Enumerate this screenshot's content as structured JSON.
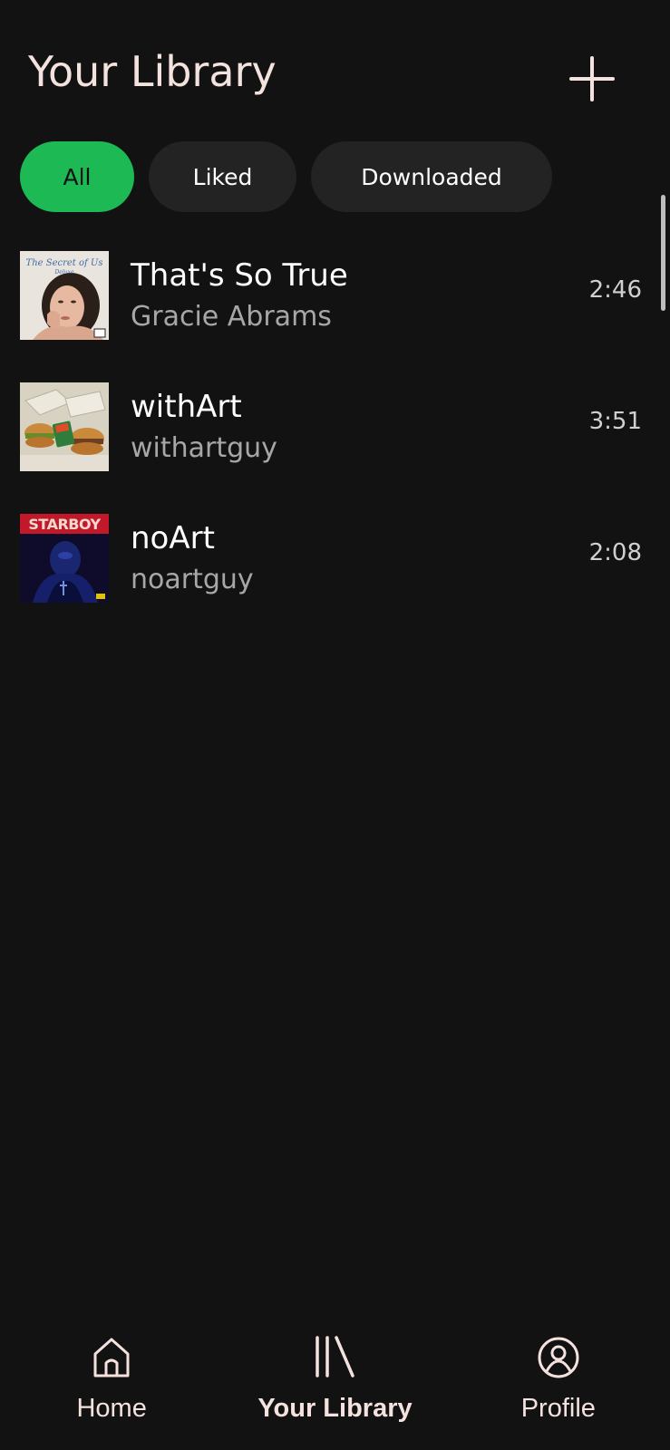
{
  "header": {
    "title": "Your Library",
    "add_icon": "plus-icon"
  },
  "filters": [
    {
      "label": "All",
      "active": true
    },
    {
      "label": "Liked",
      "active": false
    },
    {
      "label": "Downloaded",
      "active": false
    }
  ],
  "tracks": [
    {
      "title": "That's So True",
      "artist": "Gracie Abrams",
      "duration": "2:46",
      "cover_text": "The Secret of Us",
      "cover_subtext": "Deluxe"
    },
    {
      "title": "withArt",
      "artist": "withartguy",
      "duration": "3:51"
    },
    {
      "title": "noArt",
      "artist": "noartguy",
      "duration": "2:08",
      "cover_text": "STARBOY"
    }
  ],
  "bottom_nav": [
    {
      "label": "Home",
      "icon": "home-icon",
      "active": false
    },
    {
      "label": "Your Library",
      "icon": "library-icon",
      "active": true
    },
    {
      "label": "Profile",
      "icon": "profile-icon",
      "active": false
    }
  ],
  "colors": {
    "background": "#121212",
    "accent": "#1db954",
    "title": "#f4e2df",
    "chip_bg": "#232323",
    "secondary_text": "#a7a7a7"
  }
}
